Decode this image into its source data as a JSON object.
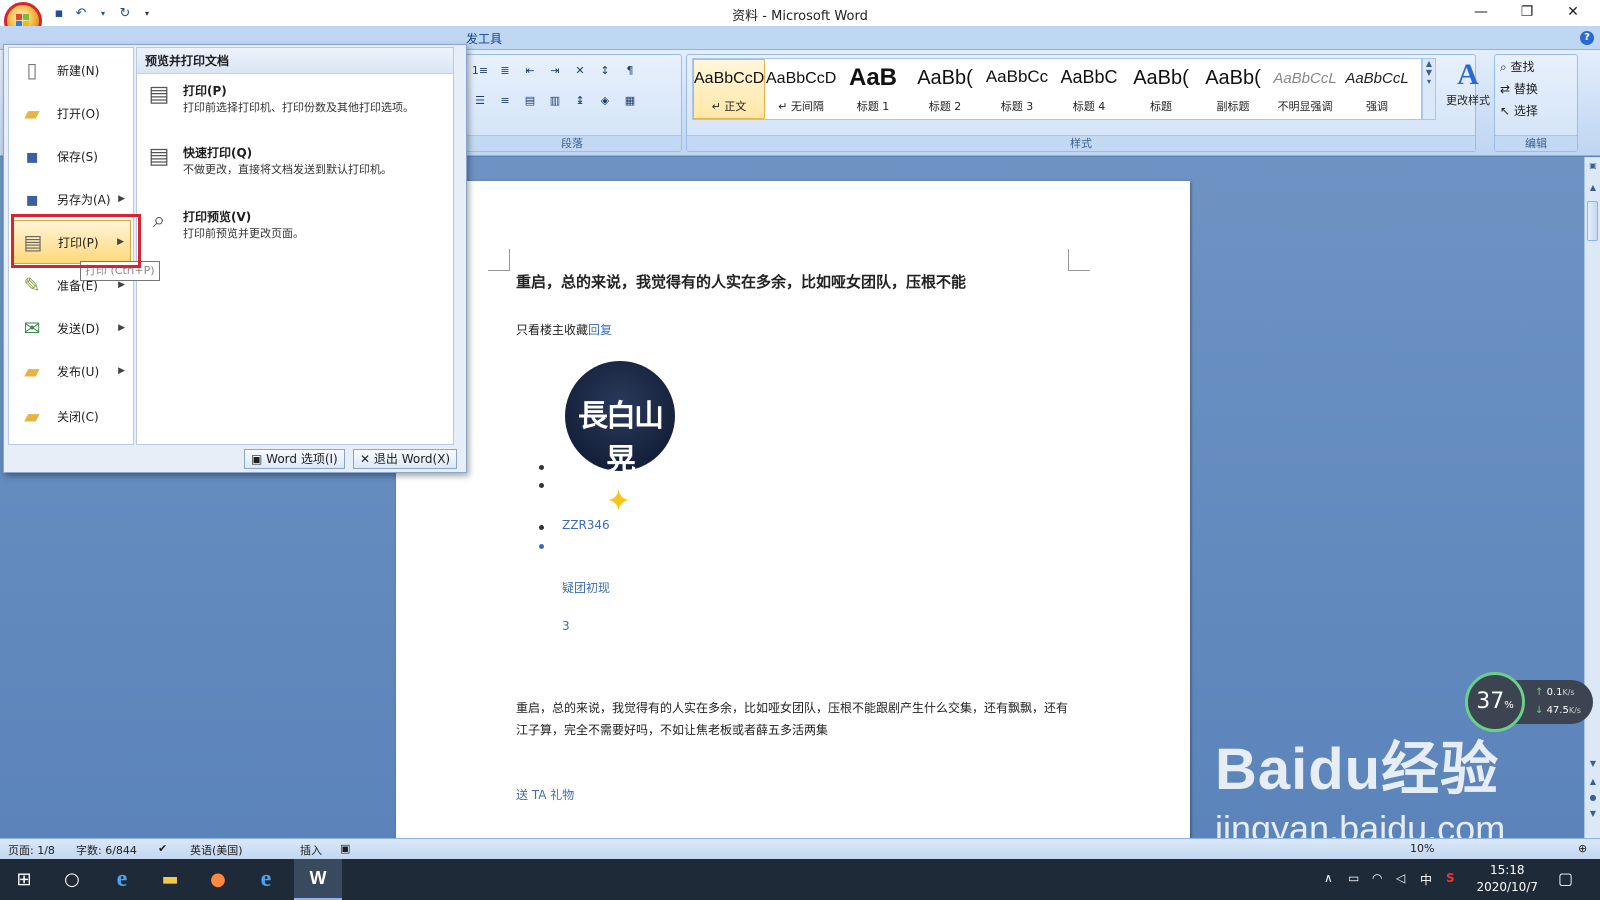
{
  "window": {
    "title": "资料 - Microsoft Word",
    "minimize": "—",
    "restore": "❐",
    "close": "✕"
  },
  "ribbon": {
    "tab_partial": "发工具",
    "paragraph_label": "段落",
    "styles_label": "样式",
    "editing_label": "编辑",
    "styles": [
      {
        "sample": "AaBbCcD",
        "name": "↵ 正文"
      },
      {
        "sample": "AaBbCcD",
        "name": "↵ 无间隔"
      },
      {
        "sample": "AaB",
        "name": "标题 1"
      },
      {
        "sample": "AaBb(",
        "name": "标题 2"
      },
      {
        "sample": "AaBbCc",
        "name": "标题 3"
      },
      {
        "sample": "AaBbC",
        "name": "标题 4"
      },
      {
        "sample": "AaBb(",
        "name": "标题"
      },
      {
        "sample": "AaBb(",
        "name": "副标题"
      },
      {
        "sample": "AaBbCcL",
        "name": "不明显强调"
      },
      {
        "sample": "AaBbCcL",
        "name": "强调"
      }
    ],
    "change_styles": "更改样式",
    "find": "查找",
    "replace": "替换",
    "select": "选择"
  },
  "office_menu": {
    "items": [
      {
        "label": "新建(N)"
      },
      {
        "label": "打开(O)"
      },
      {
        "label": "保存(S)"
      },
      {
        "label": "另存为(A)"
      },
      {
        "label": "打印(P)"
      },
      {
        "label": "准备(E)"
      },
      {
        "label": "发送(D)"
      },
      {
        "label": "发布(U)"
      },
      {
        "label": "关闭(C)"
      }
    ],
    "submenu_title": "预览并打印文档",
    "sub_items": [
      {
        "title": "打印(P)",
        "desc": "打印前选择打印机、打印份数及其他打印选项。"
      },
      {
        "title": "快速打印(Q)",
        "desc": "不做更改，直接将文档发送到默认打印机。"
      },
      {
        "title": "打印预览(V)",
        "desc": "打印前预览并更改页面。"
      }
    ],
    "word_options": "Word 选项(I)",
    "exit_word": "退出 Word(X)",
    "tooltip": "打印 (Ctrl+P)"
  },
  "document": {
    "heading": "重启，总的来说，我觉得有的人实在多余，比如哑女团队，压根不能",
    "only_op": "只看楼主收藏",
    "reply": "回复",
    "avatar_text": "長白山晃",
    "username": "ZZR346",
    "badge": "疑团初现",
    "level": "3",
    "para1": "重启，总的来说，我觉得有的人实在多余，比如哑女团队，压根不能跟剧产生什么交集，还有飘飘，还有",
    "para2": "江子算，完全不需要好吗，不如让焦老板或者薛五多活两集",
    "gift": "送 TA 礼物"
  },
  "statusbar": {
    "page": "页面: 1/8",
    "words": "字数: 6/844",
    "language": "英语(美国)",
    "insert": "插入",
    "zoom": "10%"
  },
  "speed_widget": {
    "percent": "37",
    "percent_unit": "%",
    "up": "0.1",
    "down": "47.5",
    "unit": "K/s"
  },
  "taskbar": {
    "time": "15:18",
    "date": "2020/10/7",
    "ime": "中"
  },
  "watermark": {
    "brand": "Baidu经验",
    "url": "jingyan.baidu.com"
  }
}
